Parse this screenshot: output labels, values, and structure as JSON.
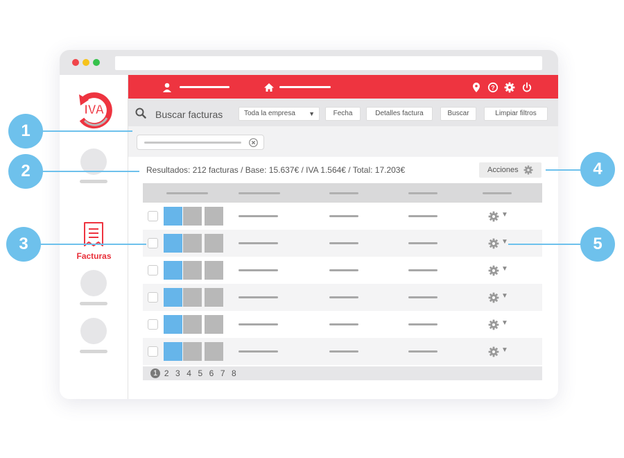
{
  "colors": {
    "brand": "#ee3440",
    "callout": "#6ec1ec",
    "thumb_active": "#66b5ea",
    "thumb_inactive": "#b8b8b8"
  },
  "brand": {
    "logo_text": "IVA"
  },
  "sidebar": {
    "active_item": {
      "label": "Facturas",
      "icon": "invoice-icon"
    }
  },
  "topbar": {
    "icons": [
      "user-icon",
      "home-icon",
      "location-pin-icon",
      "help-icon",
      "gear-icon",
      "power-icon"
    ]
  },
  "search": {
    "title": "Buscar facturas",
    "company_select": "Toda la empresa",
    "date_button": "Fecha",
    "details_button": "Detalles factura",
    "search_button": "Buscar",
    "clear_button": "Limpiar filtros"
  },
  "results": {
    "summary": "Resultados: 212 facturas / Base: 15.637€ / IVA 1.564€ / Total:  17.203€"
  },
  "actions": {
    "label": "Acciones"
  },
  "table": {
    "row_count": 6
  },
  "pagination": {
    "pages": [
      "1",
      "2",
      "3",
      "4",
      "5",
      "6",
      "7",
      "8"
    ],
    "current": "1"
  },
  "callouts": [
    "1",
    "2",
    "3",
    "4",
    "5"
  ]
}
